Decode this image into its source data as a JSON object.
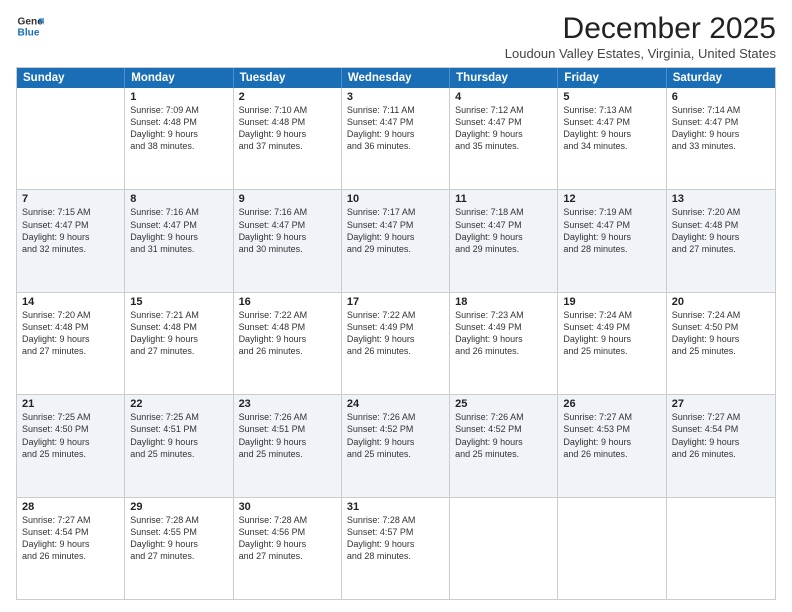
{
  "logo": {
    "general": "General",
    "blue": "Blue"
  },
  "title": "December 2025",
  "subtitle": "Loudoun Valley Estates, Virginia, United States",
  "days_of_week": [
    "Sunday",
    "Monday",
    "Tuesday",
    "Wednesday",
    "Thursday",
    "Friday",
    "Saturday"
  ],
  "rows": [
    [
      {
        "day": "",
        "lines": []
      },
      {
        "day": "1",
        "lines": [
          "Sunrise: 7:09 AM",
          "Sunset: 4:48 PM",
          "Daylight: 9 hours",
          "and 38 minutes."
        ]
      },
      {
        "day": "2",
        "lines": [
          "Sunrise: 7:10 AM",
          "Sunset: 4:48 PM",
          "Daylight: 9 hours",
          "and 37 minutes."
        ]
      },
      {
        "day": "3",
        "lines": [
          "Sunrise: 7:11 AM",
          "Sunset: 4:47 PM",
          "Daylight: 9 hours",
          "and 36 minutes."
        ]
      },
      {
        "day": "4",
        "lines": [
          "Sunrise: 7:12 AM",
          "Sunset: 4:47 PM",
          "Daylight: 9 hours",
          "and 35 minutes."
        ]
      },
      {
        "day": "5",
        "lines": [
          "Sunrise: 7:13 AM",
          "Sunset: 4:47 PM",
          "Daylight: 9 hours",
          "and 34 minutes."
        ]
      },
      {
        "day": "6",
        "lines": [
          "Sunrise: 7:14 AM",
          "Sunset: 4:47 PM",
          "Daylight: 9 hours",
          "and 33 minutes."
        ]
      }
    ],
    [
      {
        "day": "7",
        "lines": [
          "Sunrise: 7:15 AM",
          "Sunset: 4:47 PM",
          "Daylight: 9 hours",
          "and 32 minutes."
        ]
      },
      {
        "day": "8",
        "lines": [
          "Sunrise: 7:16 AM",
          "Sunset: 4:47 PM",
          "Daylight: 9 hours",
          "and 31 minutes."
        ]
      },
      {
        "day": "9",
        "lines": [
          "Sunrise: 7:16 AM",
          "Sunset: 4:47 PM",
          "Daylight: 9 hours",
          "and 30 minutes."
        ]
      },
      {
        "day": "10",
        "lines": [
          "Sunrise: 7:17 AM",
          "Sunset: 4:47 PM",
          "Daylight: 9 hours",
          "and 29 minutes."
        ]
      },
      {
        "day": "11",
        "lines": [
          "Sunrise: 7:18 AM",
          "Sunset: 4:47 PM",
          "Daylight: 9 hours",
          "and 29 minutes."
        ]
      },
      {
        "day": "12",
        "lines": [
          "Sunrise: 7:19 AM",
          "Sunset: 4:47 PM",
          "Daylight: 9 hours",
          "and 28 minutes."
        ]
      },
      {
        "day": "13",
        "lines": [
          "Sunrise: 7:20 AM",
          "Sunset: 4:48 PM",
          "Daylight: 9 hours",
          "and 27 minutes."
        ]
      }
    ],
    [
      {
        "day": "14",
        "lines": [
          "Sunrise: 7:20 AM",
          "Sunset: 4:48 PM",
          "Daylight: 9 hours",
          "and 27 minutes."
        ]
      },
      {
        "day": "15",
        "lines": [
          "Sunrise: 7:21 AM",
          "Sunset: 4:48 PM",
          "Daylight: 9 hours",
          "and 27 minutes."
        ]
      },
      {
        "day": "16",
        "lines": [
          "Sunrise: 7:22 AM",
          "Sunset: 4:48 PM",
          "Daylight: 9 hours",
          "and 26 minutes."
        ]
      },
      {
        "day": "17",
        "lines": [
          "Sunrise: 7:22 AM",
          "Sunset: 4:49 PM",
          "Daylight: 9 hours",
          "and 26 minutes."
        ]
      },
      {
        "day": "18",
        "lines": [
          "Sunrise: 7:23 AM",
          "Sunset: 4:49 PM",
          "Daylight: 9 hours",
          "and 26 minutes."
        ]
      },
      {
        "day": "19",
        "lines": [
          "Sunrise: 7:24 AM",
          "Sunset: 4:49 PM",
          "Daylight: 9 hours",
          "and 25 minutes."
        ]
      },
      {
        "day": "20",
        "lines": [
          "Sunrise: 7:24 AM",
          "Sunset: 4:50 PM",
          "Daylight: 9 hours",
          "and 25 minutes."
        ]
      }
    ],
    [
      {
        "day": "21",
        "lines": [
          "Sunrise: 7:25 AM",
          "Sunset: 4:50 PM",
          "Daylight: 9 hours",
          "and 25 minutes."
        ]
      },
      {
        "day": "22",
        "lines": [
          "Sunrise: 7:25 AM",
          "Sunset: 4:51 PM",
          "Daylight: 9 hours",
          "and 25 minutes."
        ]
      },
      {
        "day": "23",
        "lines": [
          "Sunrise: 7:26 AM",
          "Sunset: 4:51 PM",
          "Daylight: 9 hours",
          "and 25 minutes."
        ]
      },
      {
        "day": "24",
        "lines": [
          "Sunrise: 7:26 AM",
          "Sunset: 4:52 PM",
          "Daylight: 9 hours",
          "and 25 minutes."
        ]
      },
      {
        "day": "25",
        "lines": [
          "Sunrise: 7:26 AM",
          "Sunset: 4:52 PM",
          "Daylight: 9 hours",
          "and 25 minutes."
        ]
      },
      {
        "day": "26",
        "lines": [
          "Sunrise: 7:27 AM",
          "Sunset: 4:53 PM",
          "Daylight: 9 hours",
          "and 26 minutes."
        ]
      },
      {
        "day": "27",
        "lines": [
          "Sunrise: 7:27 AM",
          "Sunset: 4:54 PM",
          "Daylight: 9 hours",
          "and 26 minutes."
        ]
      }
    ],
    [
      {
        "day": "28",
        "lines": [
          "Sunrise: 7:27 AM",
          "Sunset: 4:54 PM",
          "Daylight: 9 hours",
          "and 26 minutes."
        ]
      },
      {
        "day": "29",
        "lines": [
          "Sunrise: 7:28 AM",
          "Sunset: 4:55 PM",
          "Daylight: 9 hours",
          "and 27 minutes."
        ]
      },
      {
        "day": "30",
        "lines": [
          "Sunrise: 7:28 AM",
          "Sunset: 4:56 PM",
          "Daylight: 9 hours",
          "and 27 minutes."
        ]
      },
      {
        "day": "31",
        "lines": [
          "Sunrise: 7:28 AM",
          "Sunset: 4:57 PM",
          "Daylight: 9 hours",
          "and 28 minutes."
        ]
      },
      {
        "day": "",
        "lines": []
      },
      {
        "day": "",
        "lines": []
      },
      {
        "day": "",
        "lines": []
      }
    ]
  ]
}
